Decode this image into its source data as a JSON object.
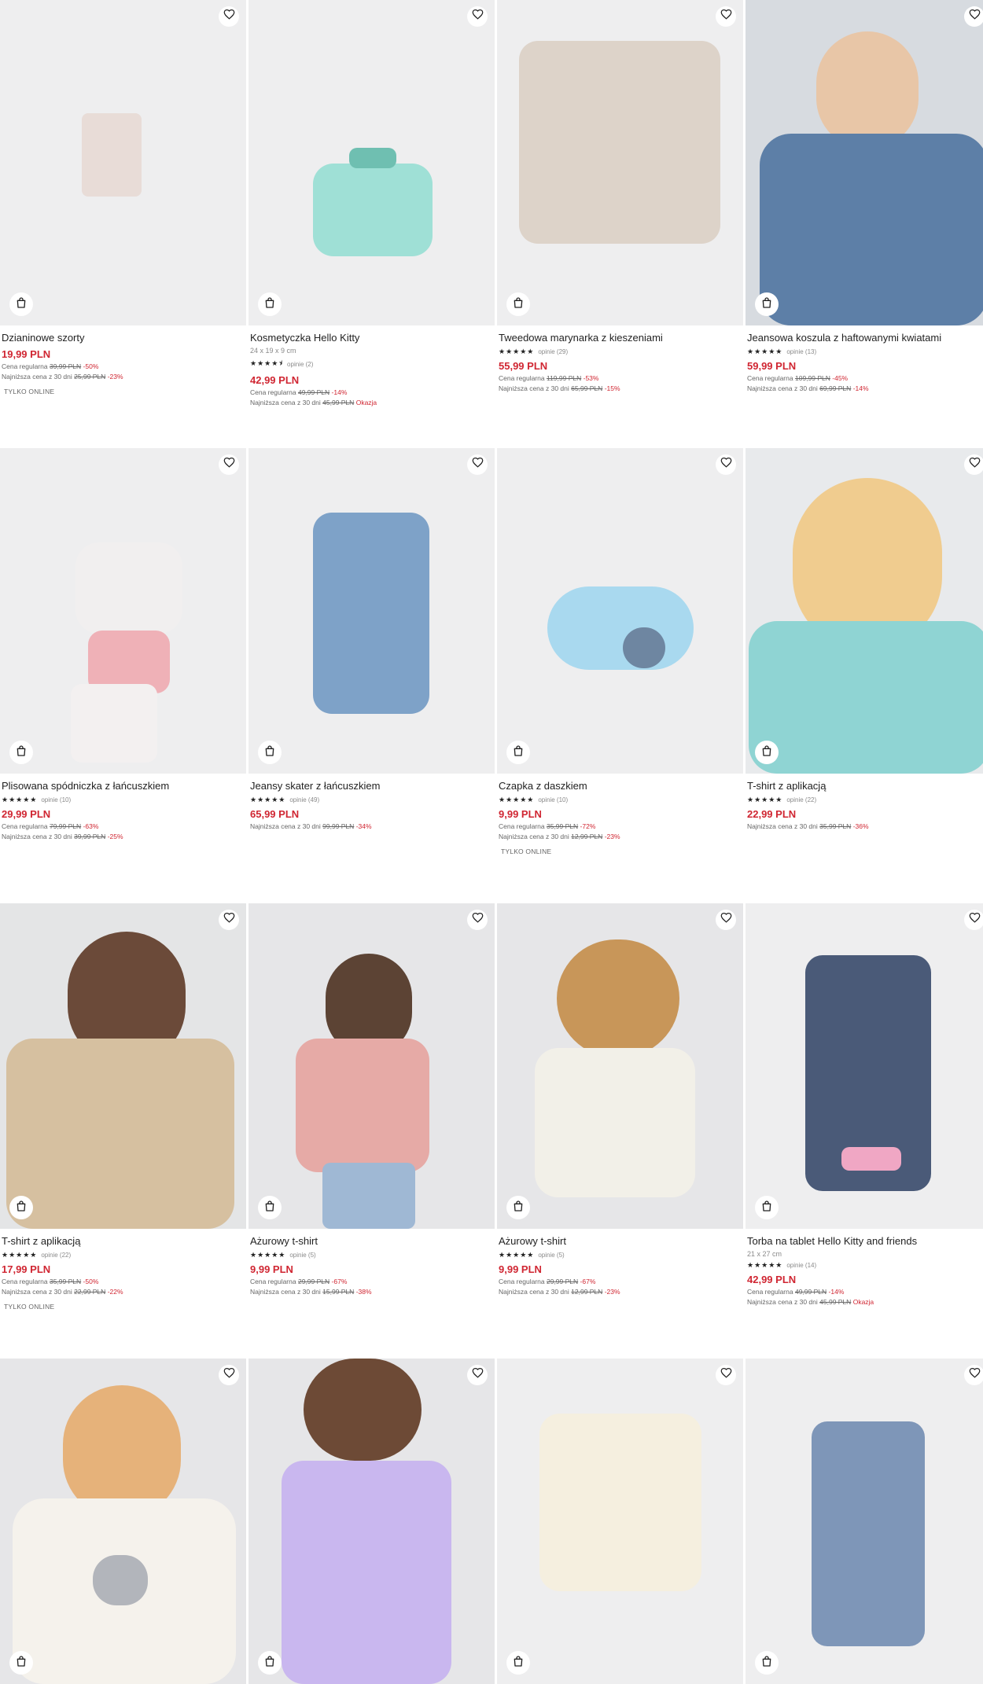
{
  "icons": {
    "favorite": "heart-outline-icon",
    "cart": "shopping-bag-icon"
  },
  "colors": {
    "price": "#d02632",
    "tile_background": "#eeeeef"
  },
  "products": [
    {
      "name": "Dzianinowe szorty",
      "price": "19,99 PLN",
      "regular_label": "Cena regularna",
      "regular_old": "39,99 PLN",
      "regular_pct": "-50%",
      "lowest_label": "Najniższa cena z 30 dni",
      "lowest_old": "25,99 PLN",
      "lowest_pct": "-23%",
      "badge": "TYLKO ONLINE"
    },
    {
      "name": "Kosmetyczka Hello Kitty",
      "dims": "24 x 19 x 9 cm",
      "stars": "★★★★⯨",
      "opinions": "opinie (2)",
      "price": "42,99 PLN",
      "regular_label": "Cena regularna",
      "regular_old": "49,99 PLN",
      "regular_pct": "-14%",
      "lowest_label": "Najniższa cena z 30 dni",
      "lowest_old": "45,99 PLN",
      "lowest_deal": "Okazja"
    },
    {
      "name": "Tweedowa marynarka z kieszeniami",
      "stars": "★★★★★",
      "opinions": "opinie (29)",
      "price": "55,99 PLN",
      "regular_label": "Cena regularna",
      "regular_old": "119,99 PLN",
      "regular_pct": "-53%",
      "lowest_label": "Najniższa cena z 30 dni",
      "lowest_old": "65,99 PLN",
      "lowest_pct": "-15%"
    },
    {
      "name": "Jeansowa koszula z haftowanymi kwiatami",
      "stars": "★★★★★",
      "opinions": "opinie (13)",
      "price": "59,99 PLN",
      "regular_label": "Cena regularna",
      "regular_old": "109,99 PLN",
      "regular_pct": "-45%",
      "lowest_label": "Najniższa cena z 30 dni",
      "lowest_old": "69,99 PLN",
      "lowest_pct": "-14%"
    },
    {
      "name": "Plisowana spódniczka z łańcuszkiem",
      "stars": "★★★★★",
      "opinions": "opinie (10)",
      "price": "29,99 PLN",
      "regular_label": "Cena regularna",
      "regular_old": "79,99 PLN",
      "regular_pct": "-63%",
      "lowest_label": "Najniższa cena z 30 dni",
      "lowest_old": "39,99 PLN",
      "lowest_pct": "-25%"
    },
    {
      "name": "Jeansy skater z łańcuszkiem",
      "stars": "★★★★★",
      "opinions": "opinie (49)",
      "price": "65,99 PLN",
      "lowest_label": "Najniższa cena z 30 dni",
      "lowest_old": "99,99 PLN",
      "lowest_pct": "-34%"
    },
    {
      "name": "Czapka z daszkiem",
      "stars": "★★★★★",
      "opinions": "opinie (10)",
      "price": "9,99 PLN",
      "regular_label": "Cena regularna",
      "regular_old": "35,99 PLN",
      "regular_pct": "-72%",
      "lowest_label": "Najniższa cena z 30 dni",
      "lowest_old": "12,99 PLN",
      "lowest_pct": "-23%",
      "badge": "TYLKO ONLINE"
    },
    {
      "name": "T-shirt z aplikacją",
      "stars": "★★★★★",
      "opinions": "opinie (22)",
      "price": "22,99 PLN",
      "lowest_label": "Najniższa cena z 30 dni",
      "lowest_old": "35,99 PLN",
      "lowest_pct": "-36%"
    },
    {
      "name": "T-shirt z aplikacją",
      "stars": "★★★★★",
      "opinions": "opinie (22)",
      "price": "17,99 PLN",
      "regular_label": "Cena regularna",
      "regular_old": "35,99 PLN",
      "regular_pct": "-50%",
      "lowest_label": "Najniższa cena z 30 dni",
      "lowest_old": "22,99 PLN",
      "lowest_pct": "-22%",
      "badge": "TYLKO ONLINE"
    },
    {
      "name": "Ażurowy t-shirt",
      "stars": "★★★★★",
      "opinions": "opinie (5)",
      "price": "9,99 PLN",
      "regular_label": "Cena regularna",
      "regular_old": "29,99 PLN",
      "regular_pct": "-67%",
      "lowest_label": "Najniższa cena z 30 dni",
      "lowest_old": "15,99 PLN",
      "lowest_pct": "-38%"
    },
    {
      "name": "Ażurowy t-shirt",
      "stars": "★★★★★",
      "opinions": "opinie (5)",
      "price": "9,99 PLN",
      "regular_label": "Cena regularna",
      "regular_old": "29,99 PLN",
      "regular_pct": "-67%",
      "lowest_label": "Najniższa cena z 30 dni",
      "lowest_old": "12,99 PLN",
      "lowest_pct": "-23%"
    },
    {
      "name": "Torba na tablet Hello Kitty and friends",
      "dims": "21 x 27 cm",
      "stars": "★★★★★",
      "opinions": "opinie (14)",
      "price": "42,99 PLN",
      "regular_label": "Cena regularna",
      "regular_old": "49,99 PLN",
      "regular_pct": "-14%",
      "lowest_label": "Najniższa cena z 30 dni",
      "lowest_old": "45,99 PLN",
      "lowest_deal": "Okazja"
    },
    {},
    {},
    {},
    {}
  ]
}
